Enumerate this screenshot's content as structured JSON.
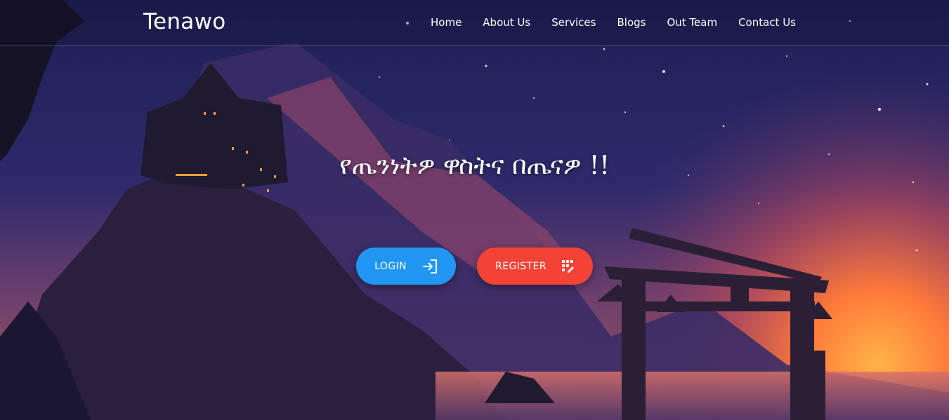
{
  "navbar": {
    "brand": "Tenawo",
    "items": [
      {
        "label": "Home"
      },
      {
        "label": "About Us"
      },
      {
        "label": "Services"
      },
      {
        "label": "Blogs"
      },
      {
        "label": "Out Team"
      },
      {
        "label": "Contact Us"
      }
    ]
  },
  "hero": {
    "headline": "የጤንነትዎ ዋስትና በጤናዎ !!",
    "login_label": "LOGIN",
    "login_icon": "login-arrow-icon",
    "register_label": "REGISTER",
    "register_icon": "register-grid-icon"
  },
  "colors": {
    "login_button": "#2196f3",
    "register_button": "#f44336"
  }
}
